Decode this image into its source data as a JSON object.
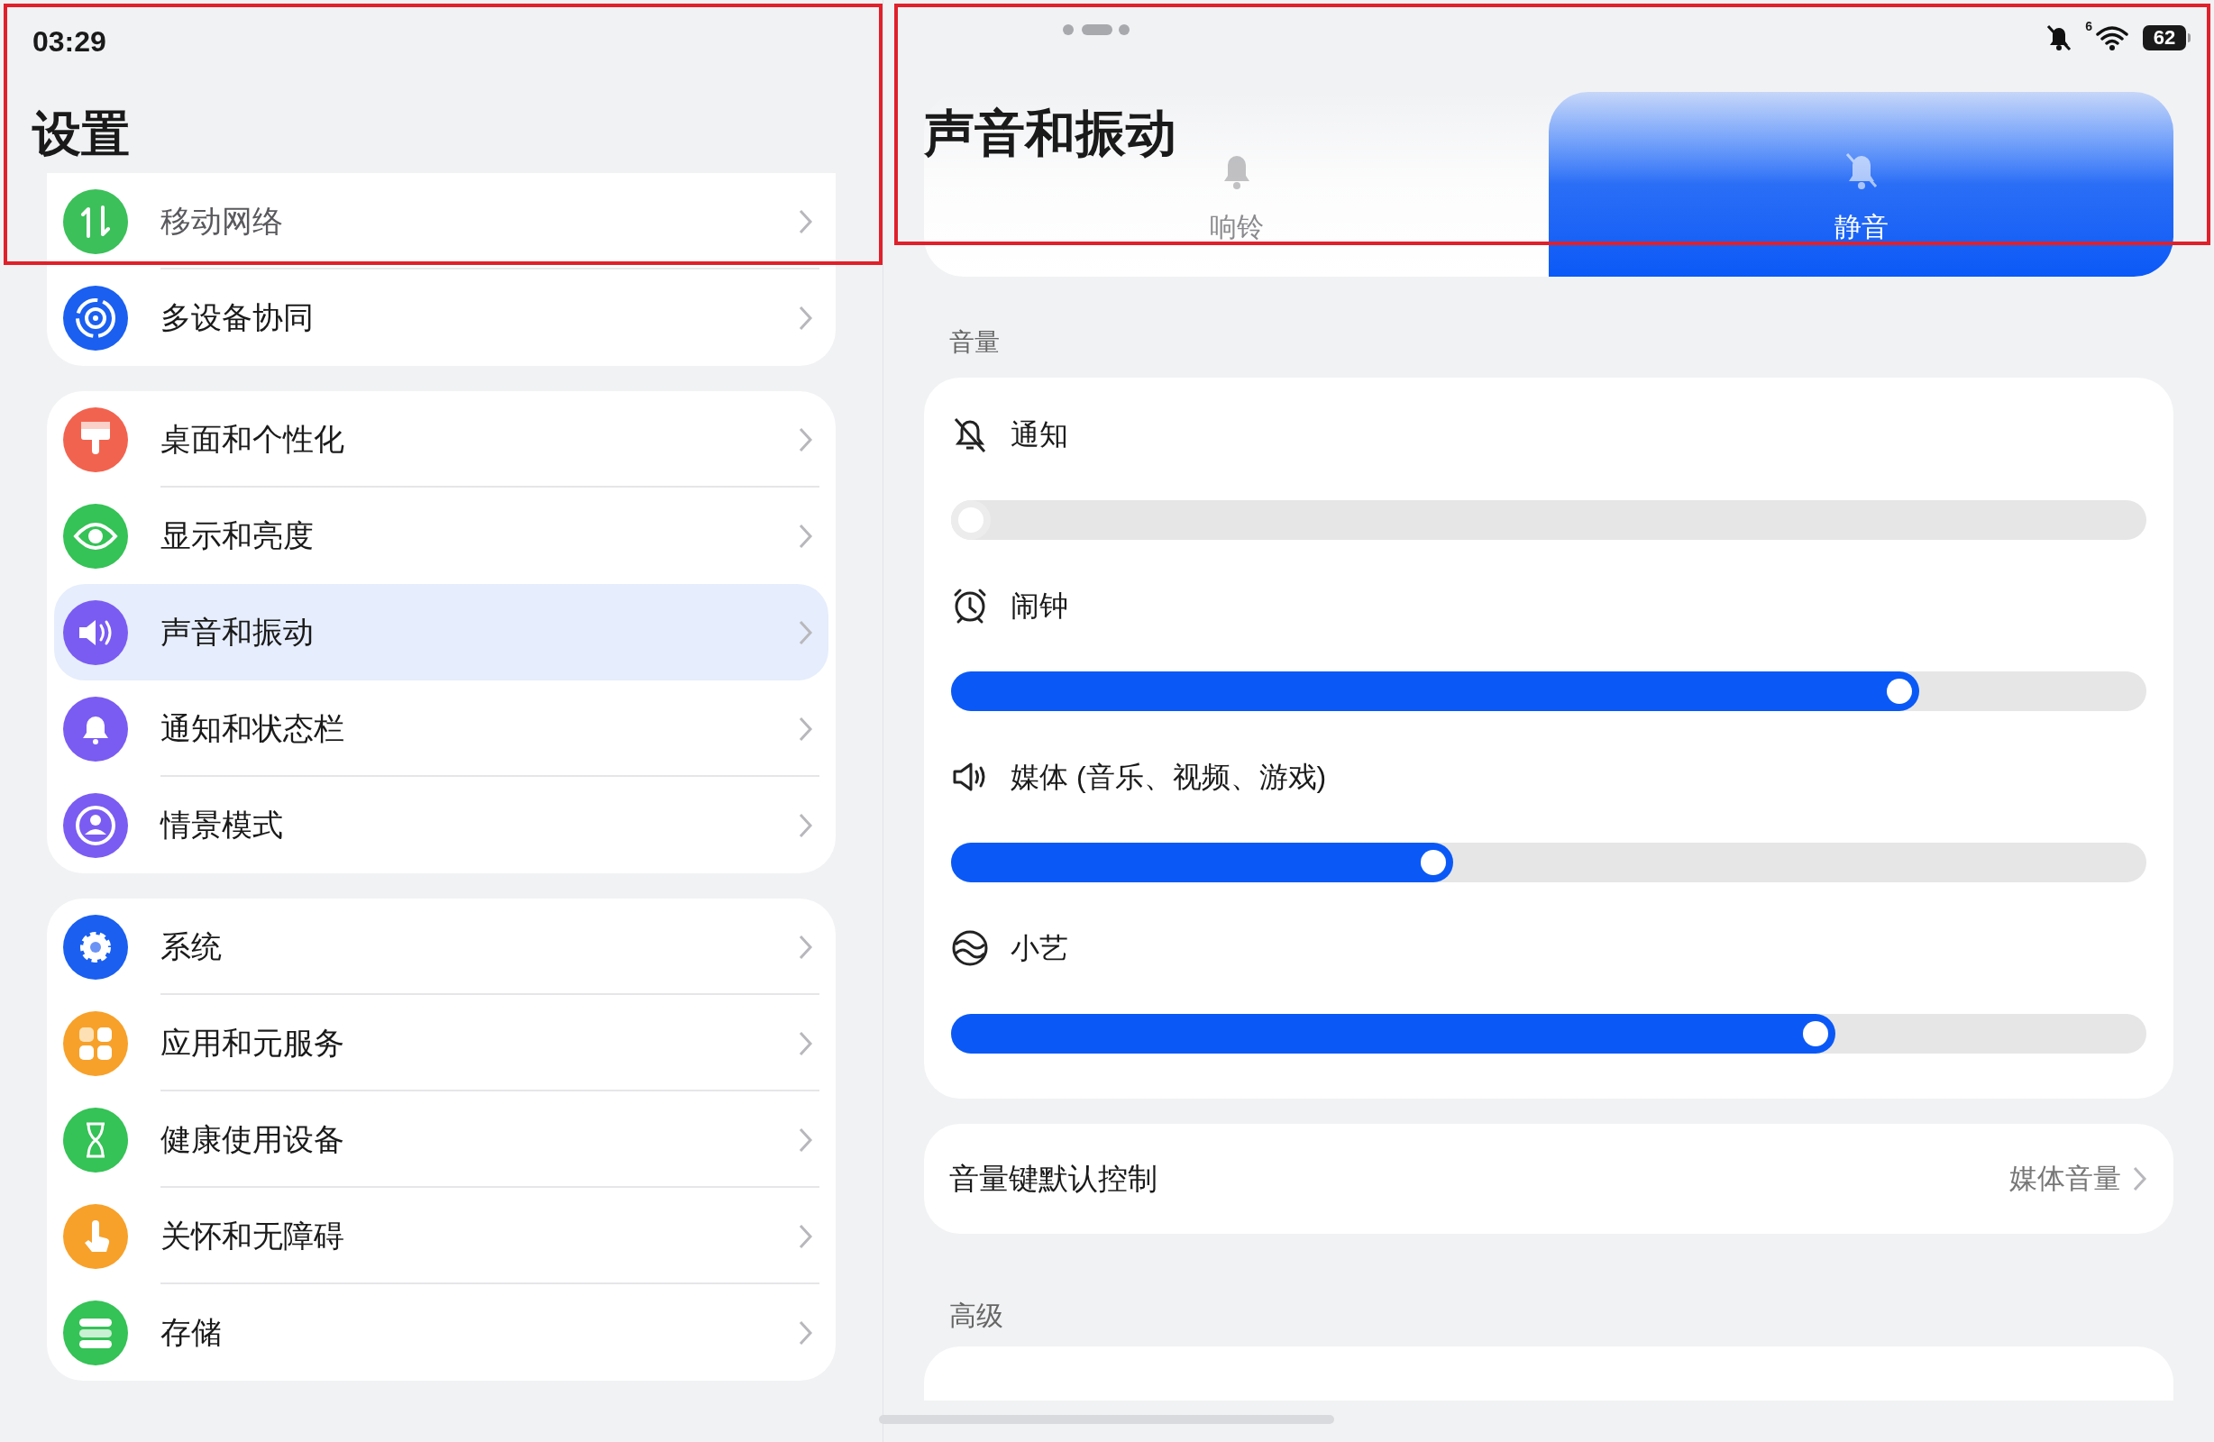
{
  "status_bar": {
    "time": "03:29",
    "wifi_badge": "6",
    "battery": "62"
  },
  "sidebar": {
    "title": "设置",
    "groups": [
      [
        {
          "label": "移动网络",
          "kind": "network",
          "color": "#3cc05a",
          "selected": false,
          "faded": true
        },
        {
          "label": "多设备协同",
          "kind": "devices",
          "color": "#1a5ff0",
          "selected": false,
          "faded": false
        }
      ],
      [
        {
          "label": "桌面和个性化",
          "kind": "brush",
          "color": "#f2634f",
          "selected": false,
          "faded": false
        },
        {
          "label": "显示和亮度",
          "kind": "eye",
          "color": "#35c256",
          "selected": false,
          "faded": false
        },
        {
          "label": "声音和振动",
          "kind": "speaker",
          "color": "#7a5cf2",
          "selected": true,
          "faded": false
        },
        {
          "label": "通知和状态栏",
          "kind": "bell",
          "color": "#7a5cf2",
          "selected": false,
          "faded": false
        },
        {
          "label": "情景模式",
          "kind": "person",
          "color": "#7a5cf2",
          "selected": false,
          "faded": false
        }
      ],
      [
        {
          "label": "系统",
          "kind": "gear",
          "color": "#1a5ff0",
          "selected": false,
          "faded": false
        },
        {
          "label": "应用和元服务",
          "kind": "apps",
          "color": "#f7a12a",
          "selected": false,
          "faded": false
        },
        {
          "label": "健康使用设备",
          "kind": "hourglass",
          "color": "#35c256",
          "selected": false,
          "faded": false
        },
        {
          "label": "关怀和无障碍",
          "kind": "hand",
          "color": "#f7a12a",
          "selected": false,
          "faded": false
        },
        {
          "label": "存储",
          "kind": "storage",
          "color": "#35c256",
          "selected": false,
          "faded": false
        }
      ]
    ]
  },
  "title": "声音和振动",
  "modes": [
    {
      "label": "响铃",
      "kind": "ring",
      "selected": false
    },
    {
      "label": "静音",
      "kind": "silent",
      "selected": true
    }
  ],
  "volume": {
    "heading": "音量",
    "channels": [
      {
        "label": "通知",
        "kind": "notification",
        "level": 0
      },
      {
        "label": "闹钟",
        "kind": "alarm",
        "level": 0.81
      },
      {
        "label": "媒体 (音乐、视频、游戏)",
        "kind": "media",
        "level": 0.42
      },
      {
        "label": "小艺",
        "kind": "assistant",
        "level": 0.74
      }
    ]
  },
  "default_control": {
    "label": "音量键默认控制",
    "value": "媒体音量"
  },
  "advanced": {
    "heading": "高级"
  }
}
